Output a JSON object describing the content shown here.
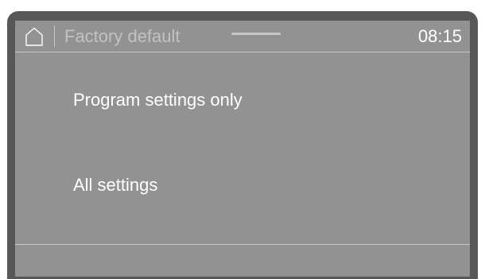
{
  "header": {
    "home_icon": "home-icon",
    "title": "Factory default",
    "time": "08:15"
  },
  "options": [
    {
      "label": "Program settings only"
    },
    {
      "label": "All settings"
    }
  ],
  "colors": {
    "bezel": "#575757",
    "screen": "#929292",
    "text": "#ffffff",
    "title_text": "#c2c2c2",
    "divider": "#c8c8c8"
  }
}
